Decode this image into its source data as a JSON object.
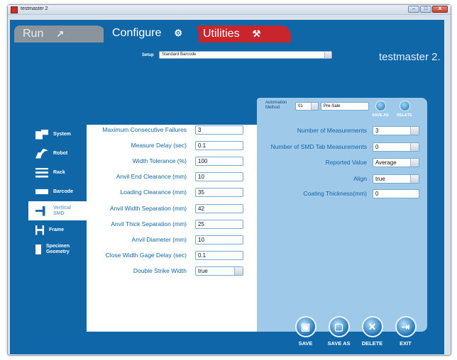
{
  "window": {
    "title": "testmaster 2",
    "controls": [
      "–",
      "□",
      "X"
    ]
  },
  "tabs": [
    {
      "label": "Run",
      "icon": "robot-arm-icon"
    },
    {
      "label": "Configure",
      "icon": "config-icon"
    },
    {
      "label": "Utilities",
      "icon": "tools-icon"
    }
  ],
  "setup": {
    "label": "Setup",
    "value": "Standard Barcode"
  },
  "brand": "testmaster 2.",
  "sidebar": [
    {
      "label": "System",
      "icon": "system-icon"
    },
    {
      "label": "Robot",
      "icon": "robot-icon"
    },
    {
      "label": "Rack",
      "icon": "rack-icon"
    },
    {
      "label": "Barcode",
      "icon": "barcode-icon"
    },
    {
      "label": "Vertical SMD",
      "line1": "Vertical",
      "line2": "SMD",
      "icon": "vertical-smd-icon",
      "active": true
    },
    {
      "label": "Frame",
      "icon": "frame-icon"
    },
    {
      "label": "Specimen Geometry",
      "line1": "Specimen",
      "line2": "Geometry",
      "icon": "specimen-icon"
    }
  ],
  "left_fields": [
    {
      "label": "Maximum Consecutive Failures",
      "value": "3"
    },
    {
      "label": "Measure Delay (sec)",
      "value": "0.1"
    },
    {
      "label": "Width Tolerance (%)",
      "value": "100"
    },
    {
      "label": "Anvil End Clearance (mm)",
      "value": "10"
    },
    {
      "label": "Loading Clearance (mm)",
      "value": "35"
    },
    {
      "label": "Anvil Width Separation (mm)",
      "value": "42"
    },
    {
      "label": "Anvil Thick Separation (mm)",
      "value": "25"
    },
    {
      "label": "Anvil Diameter (mm)",
      "value": "10"
    },
    {
      "label": "Close Width Gage Delay (sec)",
      "value": "0.1"
    },
    {
      "label": "Double Strike Width",
      "value": "true",
      "type": "select"
    }
  ],
  "automation": {
    "label_line1": "Automation",
    "label_line2": "Method",
    "number": "01",
    "name": "Pre-Sale",
    "save_as": "SAVE AS",
    "delete": "DELETE"
  },
  "right_fields": [
    {
      "label": "Number of Measurements",
      "value": "3",
      "type": "select"
    },
    {
      "label": "Number of SMD Tab Measurements",
      "value": "0",
      "type": "select"
    },
    {
      "label": "Reported Value",
      "value": "Average",
      "type": "select"
    },
    {
      "label": "Align",
      "value": "true",
      "type": "select"
    },
    {
      "label": "Coating Thickness(mm)",
      "value": "0"
    }
  ],
  "bottom_buttons": [
    {
      "label": "SAVE",
      "icon": "save-icon",
      "glyph": "▣"
    },
    {
      "label": "SAVE AS",
      "icon": "save-as-icon",
      "glyph": "▢"
    },
    {
      "label": "DELETE",
      "icon": "delete-icon",
      "glyph": "✕"
    },
    {
      "label": "EXIT",
      "icon": "exit-icon",
      "glyph": "⇥"
    }
  ]
}
